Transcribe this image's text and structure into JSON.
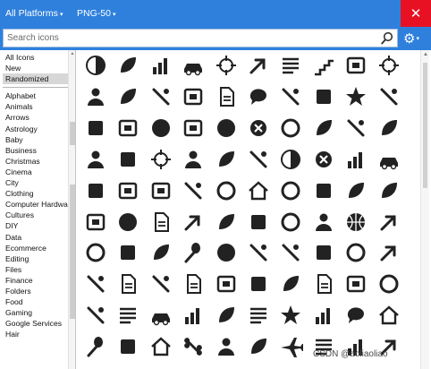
{
  "header": {
    "platform_dropdown": "All Platforms",
    "format_dropdown": "PNG-50",
    "close_glyph": "✕"
  },
  "search": {
    "placeholder": "Search icons",
    "value": ""
  },
  "sidebar": {
    "groups": [
      [
        "All Icons",
        "New",
        "Randomized"
      ],
      [
        "Alphabet",
        "Animals",
        "Arrows",
        "Astrology",
        "Baby",
        "Business",
        "Christmas",
        "Cinema",
        "City",
        "Clothing",
        "Computer Hardware",
        "Cultures",
        "DIY",
        "Data",
        "Ecommerce",
        "Editing",
        "Files",
        "Finance",
        "Folders",
        "Food",
        "Gaming",
        "Google Services",
        "Hair"
      ]
    ],
    "selected": "Randomized"
  },
  "icon_grid": [
    [
      "half-moon-icon",
      "hand-wave-icon",
      "stock-chart-icon",
      "leaf-car-icon",
      "image-search-icon",
      "collapse-arrows-icon",
      "server-rack-icon",
      "stairs-icon",
      "calendar-16-icon",
      "crosshair-icon"
    ],
    [
      "add-user-icon",
      "wolf-head-icon",
      "pliers-icon",
      "google-drive-icon",
      "wav-file-icon",
      "speech-bubble-icon",
      "remote-control-icon",
      "printer-icon",
      "compass-star-icon",
      "thermometer-icon"
    ],
    [
      "ticket-icon",
      "sd-card-icon",
      "parking-bulb-icon",
      "washing-machine-icon",
      "paw-print-icon",
      "delete-circle-icon",
      "vinyl-record-icon",
      "chili-pepper-icon",
      "hand-gun-icon",
      "bird-icon"
    ],
    [
      "running-man-icon",
      "trash-can-icon",
      "network-icon",
      "ice-skater-icon",
      "trees-icon",
      "broom-icon",
      "underwear-icon",
      "skull-bones-icon",
      "growth-chart-icon",
      "car-icon"
    ],
    [
      "t-shirt-icon",
      "stand-mixer-icon",
      "photo-frame-icon",
      "water-tap-icon",
      "opera-icon",
      "garage-icon",
      "channel-4-icon",
      "beer-mug-icon",
      "guitar-pick-icon",
      "sprout-icon"
    ],
    [
      "film-roll-icon",
      "whistle-icon",
      "map-icon",
      "arrow-down-right-icon",
      "dinosaur-icon",
      "coffin-icon",
      "snow-globe-icon",
      "woman-profile-icon",
      "basketball-icon",
      "corner-arrow-icon"
    ],
    [
      "alarm-clock-icon",
      "weight-scale-icon",
      "campfire-icon",
      "spoon-icon",
      "chef-hat-icon",
      "rifle-icon",
      "axe-icon",
      "fire-hydrant-icon",
      "life-ring-icon",
      "snorkel-icon"
    ],
    [
      "pipette-icon",
      "video-file-icon",
      "violin-icon",
      "document-icon",
      "shield-photo-icon",
      "ruler-bag-icon",
      "plant-icon",
      "excel-file-icon",
      "keyboard-icon",
      "angry-face-icon"
    ],
    [
      "cello-icon",
      "report-icon",
      "bus-icon",
      "dav-logo-icon",
      "clover-icon",
      "paper-stack-icon",
      "person-star-icon",
      "columns-icon",
      "megaphone-icon",
      "church-icon"
    ],
    [
      "pill-hand-icon",
      "lunch-box-icon",
      "house-icon",
      "bone-icon",
      "gingerbread-icon",
      "footprints-icon",
      "airplane-icon",
      "mail-list-icon",
      "barcode-icon",
      "arrow-icon"
    ]
  ],
  "watermark": "CSDN @aoliaoliao",
  "colors": {
    "accent": "#2f80dc",
    "close": "#e81123",
    "icon": "#222222",
    "selected": "#d7d7d7"
  }
}
